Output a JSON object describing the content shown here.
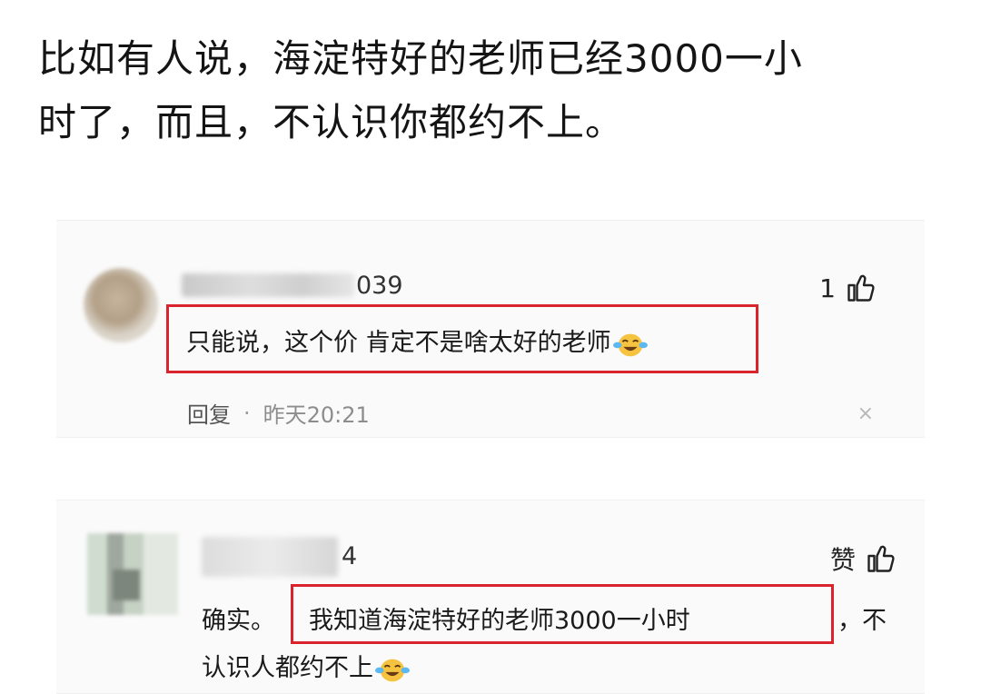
{
  "post": {
    "line1": "比如有人说，海淀特好的老师已经3000一小",
    "line2": "时了，而且，不认识你都约不上。"
  },
  "comments": [
    {
      "username_visible_suffix": "039",
      "likes": "1",
      "text": "只能说，这个价 肯定不是啥太好的老师",
      "emoji": "crying-laughing-emoji",
      "reply_label": "回复",
      "separator": "·",
      "timestamp": "昨天20:21",
      "close": "×"
    },
    {
      "username_visible_suffix": "4",
      "like_label": "赞",
      "text_prefix": "确实。",
      "text_highlighted": "我知道海淀特好的老师3000一小时",
      "text_after": "，不",
      "text_line2": "认识人都约不上",
      "emoji": "crying-laughing-emoji"
    }
  ],
  "colors": {
    "highlight_border": "#d9232d",
    "card_background": "#fafafa",
    "emoji_yellow": "#f6c340"
  }
}
